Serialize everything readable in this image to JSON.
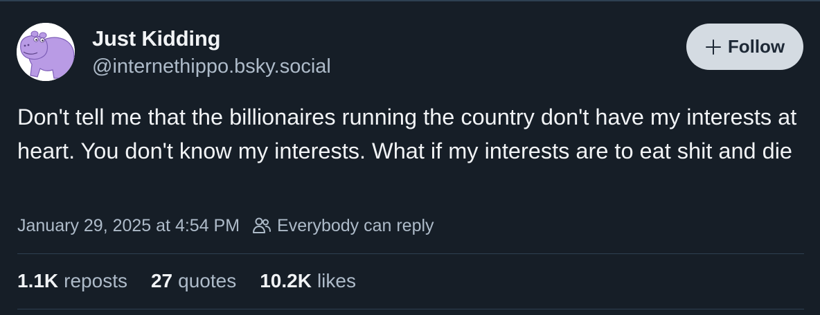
{
  "post": {
    "author": {
      "display_name": "Just Kidding",
      "handle": "@internethippo.bsky.social",
      "avatar_icon": "purple-hippo-avatar"
    },
    "follow_label": "Follow",
    "follow_icon": "plus-icon",
    "text": "Don't tell me that the billionaires running the country don't have my interests at heart. You don't know my interests. What if my interests are to eat shit and die",
    "timestamp": "January 29, 2025 at 4:54 PM",
    "reply_setting_icon": "people-icon",
    "reply_setting": "Everybody can reply",
    "stats": {
      "reposts_count": "1.1K",
      "reposts_label": "reposts",
      "quotes_count": "27",
      "quotes_label": "quotes",
      "likes_count": "10.2K",
      "likes_label": "likes"
    }
  },
  "colors": {
    "background": "#161e27",
    "primary_text": "#f1f3f5",
    "secondary_text": "#aebbc9",
    "divider": "#2e4052",
    "follow_button_bg": "#d4dbe2",
    "avatar_purple": "#b99be5"
  }
}
